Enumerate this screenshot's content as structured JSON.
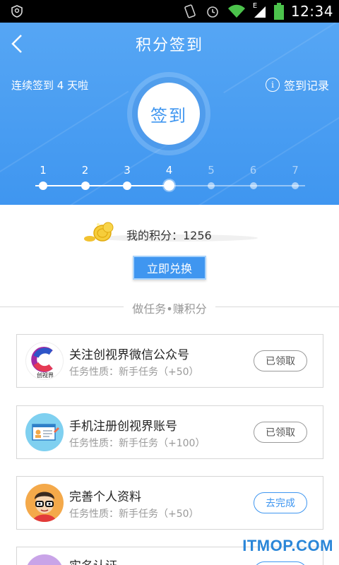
{
  "status_bar": {
    "time": "12:34",
    "network": "E"
  },
  "header": {
    "title": "积分签到",
    "streak": "连续签到 4 天啦",
    "history_label": "签到记录",
    "checkin_label": "签到",
    "days": [
      "1",
      "2",
      "3",
      "4",
      "5",
      "6",
      "7"
    ],
    "current_day": 4
  },
  "points": {
    "text": "我的积分：1256",
    "redeem_label": "立即兑换"
  },
  "tasks_section": {
    "title": "做任务•赚积分"
  },
  "tasks": [
    {
      "title": "关注创视界微信公众号",
      "sub": "任务性质：新手任务（+50）",
      "action": "已领取",
      "state": "done",
      "logo_text": "创视界"
    },
    {
      "title": "手机注册创视界账号",
      "sub": "任务性质：新手任务（+100）",
      "action": "已领取",
      "state": "done"
    },
    {
      "title": "完善个人资料",
      "sub": "任务性质：新手任务（+50）",
      "action": "去完成",
      "state": "todo"
    },
    {
      "title": "实名认证",
      "sub": "",
      "action": "",
      "state": "todo"
    }
  ],
  "watermark": "ITMOP.COM",
  "colors": {
    "primary": "#3f96f0",
    "header_top": "#56a6f4"
  }
}
